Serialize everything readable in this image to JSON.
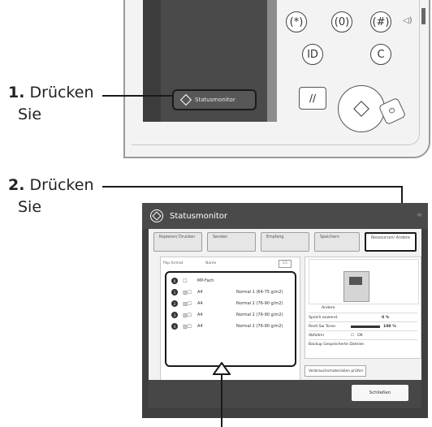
{
  "panel": {
    "keys": [
      "(*)",
      "(0)",
      "(#)",
      "ID",
      "C"
    ],
    "status_button_label": "Statusmonitor",
    "stop_symbol": "//",
    "speaker_symbol": "◁)"
  },
  "callouts": {
    "step1_number": "1.",
    "step1_text": "Drücken",
    "step1_text2": "Sie",
    "step2_number": "2.",
    "step2_text": "Drücken",
    "step2_text2": "Sie"
  },
  "status_monitor": {
    "title": "Statusmonitor",
    "tabs": [
      "Kopieren/ Drucken",
      "Senden",
      "Empfang",
      "Speichern",
      "Ressourcen/ Andere"
    ],
    "list_headers": [
      "Pap.format",
      "Name"
    ],
    "rows": [
      {
        "num": "0",
        "size": "MP-Fach",
        "name": ""
      },
      {
        "num": "1",
        "size": "A4",
        "name": "Normal 1 (64-75 g/m2)"
      },
      {
        "num": "2",
        "size": "A4",
        "name": "Normal 2 (76-90 g/m2)"
      },
      {
        "num": "3",
        "size": "A4",
        "name": "Normal 2 (76-90 g/m2)"
      },
      {
        "num": "4",
        "size": "A4",
        "name": "Normal 2 (76-90 g/m2)"
      }
    ],
    "detail_button": "Details",
    "info": [
      {
        "label": "Andere",
        "value": ""
      },
      {
        "label": "Speich.anwend.",
        "value": "0 %"
      },
      {
        "label": "Restl.Sw Toner",
        "value": "100 %"
      },
      {
        "label": "Abfallmr",
        "value": "OK"
      },
      {
        "label": "Backup Gespeicherte Dateien",
        "value": ""
      }
    ],
    "consumables_button": "Verbrauchsmaterialien prüfen",
    "close_button": "Schließen"
  }
}
